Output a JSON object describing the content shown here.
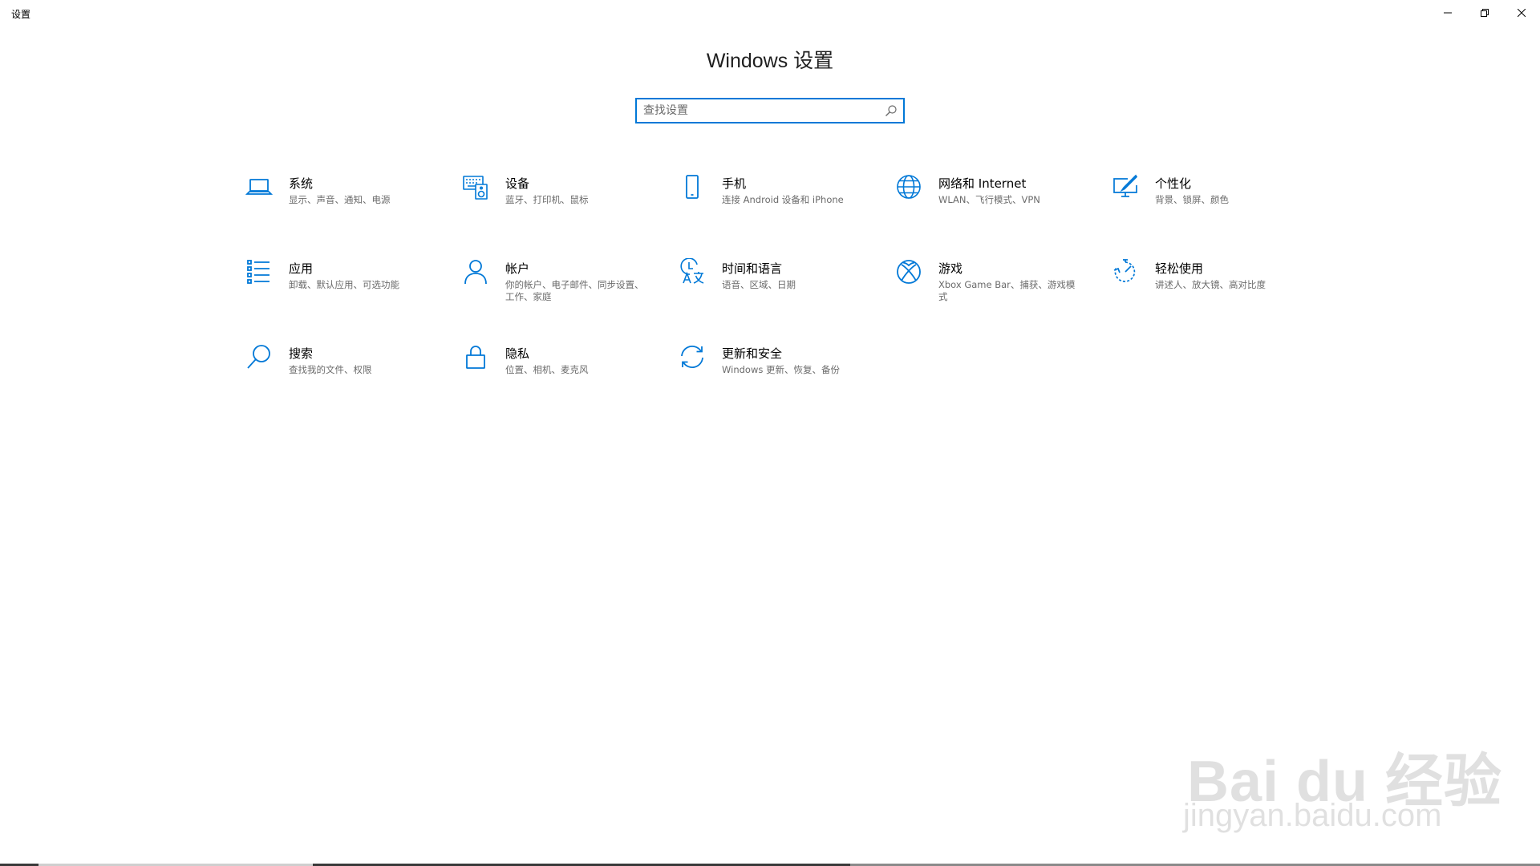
{
  "window": {
    "title": "设置",
    "controls": [
      "minimize",
      "restore",
      "close"
    ]
  },
  "page": {
    "title": "Windows 设置"
  },
  "search": {
    "placeholder": "查找设置",
    "value": ""
  },
  "categories": [
    {
      "id": "system",
      "icon": "laptop-icon",
      "title": "系统",
      "desc": "显示、声音、通知、电源"
    },
    {
      "id": "devices",
      "icon": "keyboard-speaker-icon",
      "title": "设备",
      "desc": "蓝牙、打印机、鼠标"
    },
    {
      "id": "phone",
      "icon": "phone-icon",
      "title": "手机",
      "desc": "连接 Android 设备和 iPhone"
    },
    {
      "id": "network",
      "icon": "globe-icon",
      "title": "网络和 Internet",
      "desc": "WLAN、飞行模式、VPN"
    },
    {
      "id": "personalization",
      "icon": "paint-monitor-icon",
      "title": "个性化",
      "desc": "背景、锁屏、颜色"
    },
    {
      "id": "apps",
      "icon": "list-icon",
      "title": "应用",
      "desc": "卸载、默认应用、可选功能"
    },
    {
      "id": "accounts",
      "icon": "person-icon",
      "title": "帐户",
      "desc": "你的帐户、电子邮件、同步设置、工作、家庭"
    },
    {
      "id": "time-language",
      "icon": "time-language-icon",
      "title": "时间和语言",
      "desc": "语音、区域、日期"
    },
    {
      "id": "gaming",
      "icon": "xbox-icon",
      "title": "游戏",
      "desc": "Xbox Game Bar、捕获、游戏模式"
    },
    {
      "id": "ease-of-access",
      "icon": "accessibility-timer-icon",
      "title": "轻松使用",
      "desc": "讲述人、放大镜、高对比度"
    },
    {
      "id": "search",
      "icon": "search-icon",
      "title": "搜索",
      "desc": "查找我的文件、权限"
    },
    {
      "id": "privacy",
      "icon": "lock-icon",
      "title": "隐私",
      "desc": "位置、相机、麦克风"
    },
    {
      "id": "update-security",
      "icon": "sync-icon",
      "title": "更新和安全",
      "desc": "Windows 更新、恢复、备份"
    }
  ],
  "watermark": {
    "brand": "Bai du 经验",
    "url": "jingyan.baidu.com"
  },
  "colors": {
    "accent": "#0078d7",
    "text": "#000000",
    "secondary_text": "#6b6b6b",
    "background": "#ffffff"
  }
}
